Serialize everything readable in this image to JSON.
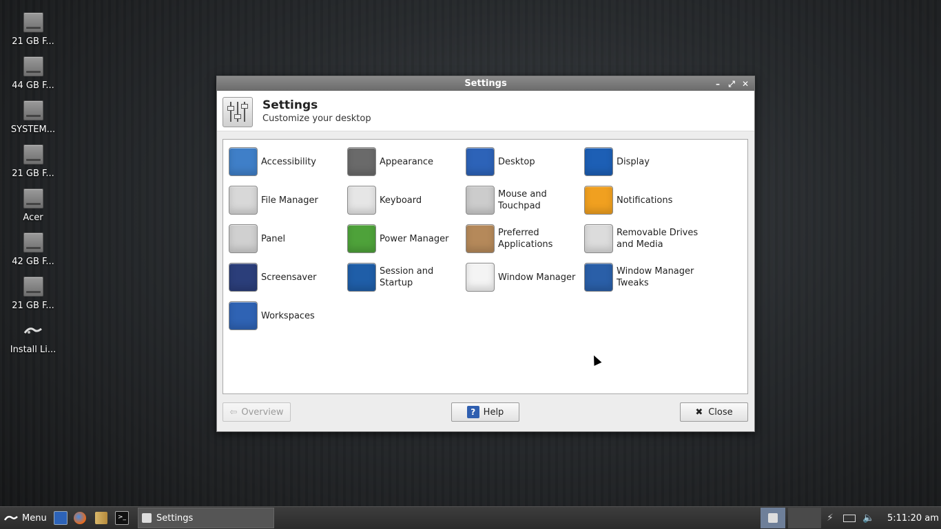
{
  "desktop": {
    "icons": [
      {
        "label": "21 GB F...",
        "icon": "drive-icon"
      },
      {
        "label": "44 GB F...",
        "icon": "drive-icon"
      },
      {
        "label": "SYSTEM...",
        "icon": "drive-icon"
      },
      {
        "label": "21 GB F...",
        "icon": "drive-icon"
      },
      {
        "label": "Acer",
        "icon": "drive-icon"
      },
      {
        "label": "42 GB F...",
        "icon": "drive-icon"
      },
      {
        "label": "21 GB F...",
        "icon": "drive-icon"
      },
      {
        "label": "Install Li...",
        "icon": "linux-lite-logo"
      }
    ]
  },
  "window": {
    "title": "Settings",
    "controls": {
      "minimize": "–",
      "maximize": "⤢",
      "close": "✕"
    },
    "header": {
      "title": "Settings",
      "subtitle": "Customize your desktop"
    },
    "items": [
      {
        "label": "Accessibility",
        "icon": "accessibility-icon",
        "color": "#3f7fc8"
      },
      {
        "label": "Appearance",
        "icon": "appearance-suit-icon",
        "color": "#6a6a6a"
      },
      {
        "label": "Desktop",
        "icon": "desktop-icon",
        "color": "#2d63b8"
      },
      {
        "label": "Display",
        "icon": "display-monitor-icon",
        "color": "#1d5fb5"
      },
      {
        "label": "File Manager",
        "icon": "file-cabinet-icon",
        "color": "#d8d8d8"
      },
      {
        "label": "Keyboard",
        "icon": "keyboard-icon",
        "color": "#e6e6e6"
      },
      {
        "label": "Mouse and Touchpad",
        "icon": "mouse-icon",
        "color": "#cccccc"
      },
      {
        "label": "Notifications",
        "icon": "notification-bubble-icon",
        "color": "#f0a020"
      },
      {
        "label": "Panel",
        "icon": "panel-icon",
        "color": "#d0d0d0"
      },
      {
        "label": "Power Manager",
        "icon": "battery-power-icon",
        "color": "#4ea23a"
      },
      {
        "label": "Preferred Applications",
        "icon": "preferred-apps-box-icon",
        "color": "#b5895a"
      },
      {
        "label": "Removable Drives and Media",
        "icon": "eject-drive-icon",
        "color": "#dcdcdc"
      },
      {
        "label": "Screensaver",
        "icon": "screensaver-moon-icon",
        "color": "#2b3e7a"
      },
      {
        "label": "Session and Startup",
        "icon": "session-user-icon",
        "color": "#1f5ea8"
      },
      {
        "label": "Window Manager",
        "icon": "window-manager-icon",
        "color": "#f4f4f4"
      },
      {
        "label": "Window Manager Tweaks",
        "icon": "window-tweaks-wand-icon",
        "color": "#2a5fa8"
      },
      {
        "label": "Workspaces",
        "icon": "workspaces-grid-icon",
        "color": "#2f63b4"
      }
    ],
    "buttons": {
      "overview": "Overview",
      "help": "Help",
      "close": "Close"
    }
  },
  "taskbar": {
    "menu_label": "Menu",
    "task_label": "Settings",
    "clock": "5:11:20 am",
    "accent": "#3a7bd5"
  }
}
